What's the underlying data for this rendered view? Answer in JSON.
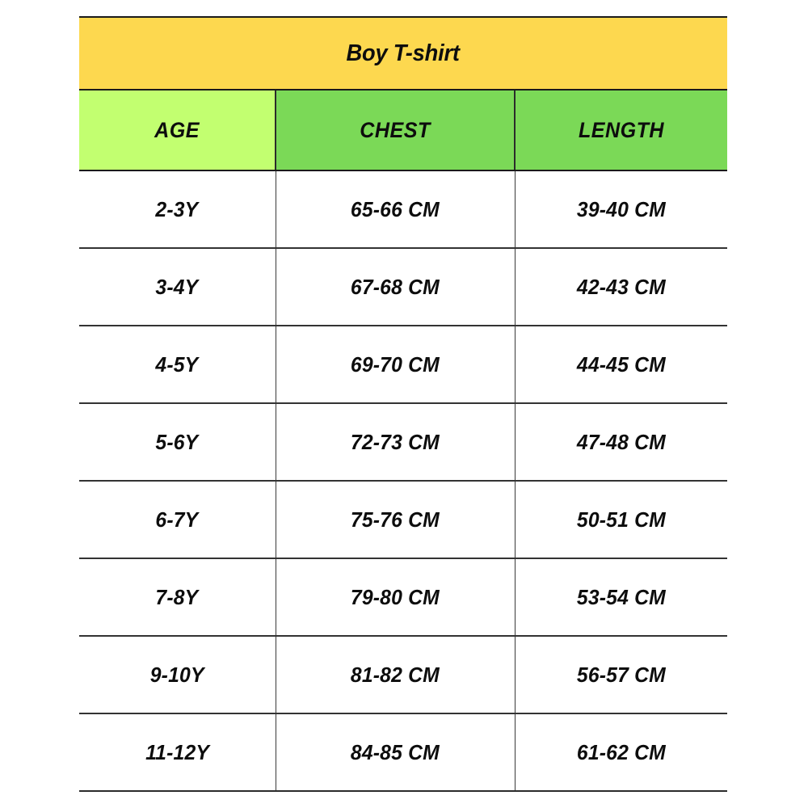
{
  "table": {
    "title": "Boy T-shirt",
    "columns": [
      "AGE",
      "CHEST",
      "LENGTH"
    ],
    "rows": [
      {
        "age": "2-3Y",
        "chest": "65-66 CM",
        "length": "39-40 CM"
      },
      {
        "age": "3-4Y",
        "chest": "67-68 CM",
        "length": "42-43 CM"
      },
      {
        "age": "4-5Y",
        "chest": "69-70 CM",
        "length": "44-45 CM"
      },
      {
        "age": "5-6Y",
        "chest": "72-73 CM",
        "length": "47-48 CM"
      },
      {
        "age": "6-7Y",
        "chest": "75-76 CM",
        "length": "50-51 CM"
      },
      {
        "age": "7-8Y",
        "chest": "79-80 CM",
        "length": "53-54 CM"
      },
      {
        "age": "9-10Y",
        "chest": "81-82 CM",
        "length": "56-57 CM"
      },
      {
        "age": "11-12Y",
        "chest": "84-85 CM",
        "length": "61-62 CM"
      }
    ],
    "colors": {
      "title_background": "#fdd84f",
      "age_header_background": "#c2ff70",
      "measure_header_background": "#7bd957",
      "cell_background": "#ffffff",
      "border": "#2b2b2b",
      "text": "#0d0d0d"
    }
  },
  "chart_data": {
    "type": "table",
    "title": "Boy T-shirt",
    "columns": [
      "AGE",
      "CHEST",
      "LENGTH"
    ],
    "rows": [
      [
        "2-3Y",
        "65-66 CM",
        "39-40 CM"
      ],
      [
        "3-4Y",
        "67-68 CM",
        "42-43 CM"
      ],
      [
        "4-5Y",
        "69-70 CM",
        "44-45 CM"
      ],
      [
        "5-6Y",
        "72-73 CM",
        "47-48 CM"
      ],
      [
        "6-7Y",
        "75-76 CM",
        "50-51 CM"
      ],
      [
        "7-8Y",
        "79-80 CM",
        "53-54 CM"
      ],
      [
        "9-10Y",
        "81-82 CM",
        "56-57 CM"
      ],
      [
        "11-12Y",
        "84-85 CM",
        "61-62 CM"
      ]
    ],
    "units": "CM",
    "row_count": 8,
    "column_count": 3
  }
}
